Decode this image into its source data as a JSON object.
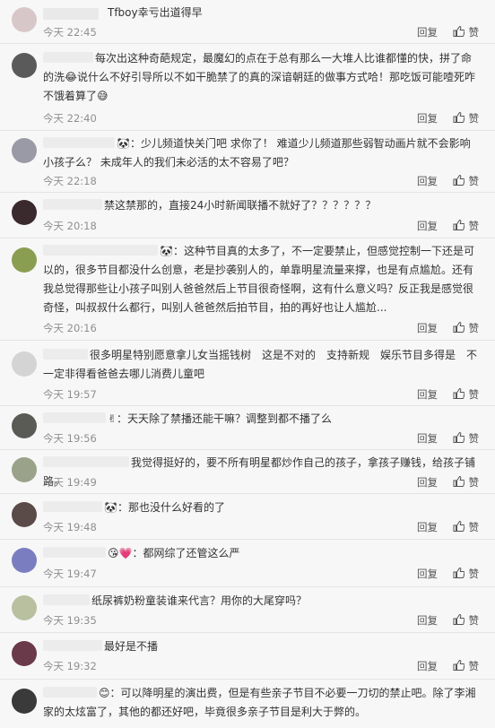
{
  "reply_label": "回复",
  "like_label": "赞",
  "comments": [
    {
      "text": "Tfboy幸亏出道得早",
      "time": "今天 22:45",
      "avatar_color": "#d8c7c9"
    },
    {
      "text": "每次出这种奇葩规定，最魔幻的点在于总有那么一大堆人比谁都懂的快，拼了命的洗😂说什么不好引导所以不如干脆禁了的真的深谙朝廷的做事方式哈！那吃饭可能噎死咋不饿着算了😅",
      "time": "今天 22:40",
      "avatar_color": "#5a5a5a"
    },
    {
      "text": "🐼：少儿频道快关门吧 求你了！ 难道少儿频道那些弱智动画片就不会影响小孩子么？ 未成年人的我们未必活的太不容易了吧？",
      "time": "今天 22:18",
      "avatar_color": "#9a9aa6"
    },
    {
      "text": "禁这禁那的，直接24小时新闻联播不就好了？？？？？？",
      "time": "今天 20:18",
      "avatar_color": "#3a2a2e"
    },
    {
      "text": "🐼：这种节目真的太多了，不一定要禁止，但感觉控制一下还是可以的，很多节目都没什么创意，老是抄袭别人的，单靠明星流量来撑，也是有点尴尬。还有我总觉得那些让小孩子叫别人爸爸然后上节目很奇怪啊，这有什么意义吗？反正我是感觉很奇怪，叫叔叔什么都行，叫别人爸爸然后拍节目，拍的再好也让人尴尬...",
      "time": "今天 20:16",
      "avatar_color": "#8a9e52"
    },
    {
      "text": "很多明星特别愿意拿儿女当摇钱树　这是不对的　支持新规　娱乐节目多得是　不一定非得看爸爸去哪儿消费儿童吧",
      "time": "今天 19:57",
      "avatar_color": "#d4d4d4"
    },
    {
      "text": "✌：天天除了禁播还能干嘛？调整到都不播了么",
      "time": "今天 19:56",
      "avatar_color": "#5b5b55"
    },
    {
      "text": "我觉得挺好的，要不所有明星都炒作自己的孩子，拿孩子赚钱，给孩子铺路。",
      "time": "今天 19:49",
      "avatar_color": "#9aa28a"
    },
    {
      "text": "🐼：那也没什么好看的了",
      "time": "今天 19:48",
      "avatar_color": "#5a4a48"
    },
    {
      "text": "😘💗：都网综了还管这么严",
      "time": "今天 19:47",
      "avatar_color": "#7a7ec0"
    },
    {
      "text": "纸尿裤奶粉童装谁来代言？用你的大尾穿吗？",
      "time": "今天 19:35",
      "avatar_color": "#b8c0a0"
    },
    {
      "text": "最好是不播",
      "time": "今天 19:32",
      "avatar_color": "#6a3a4a"
    },
    {
      "text": "😊：可以降明星的演出费，但是有些亲子节目不必要一刀切的禁止吧。除了李湘家的太炫富了，其他的都还好吧，毕竟很多亲子节目是利大于弊的。",
      "time": "",
      "avatar_color": "#3a3a3a"
    }
  ]
}
